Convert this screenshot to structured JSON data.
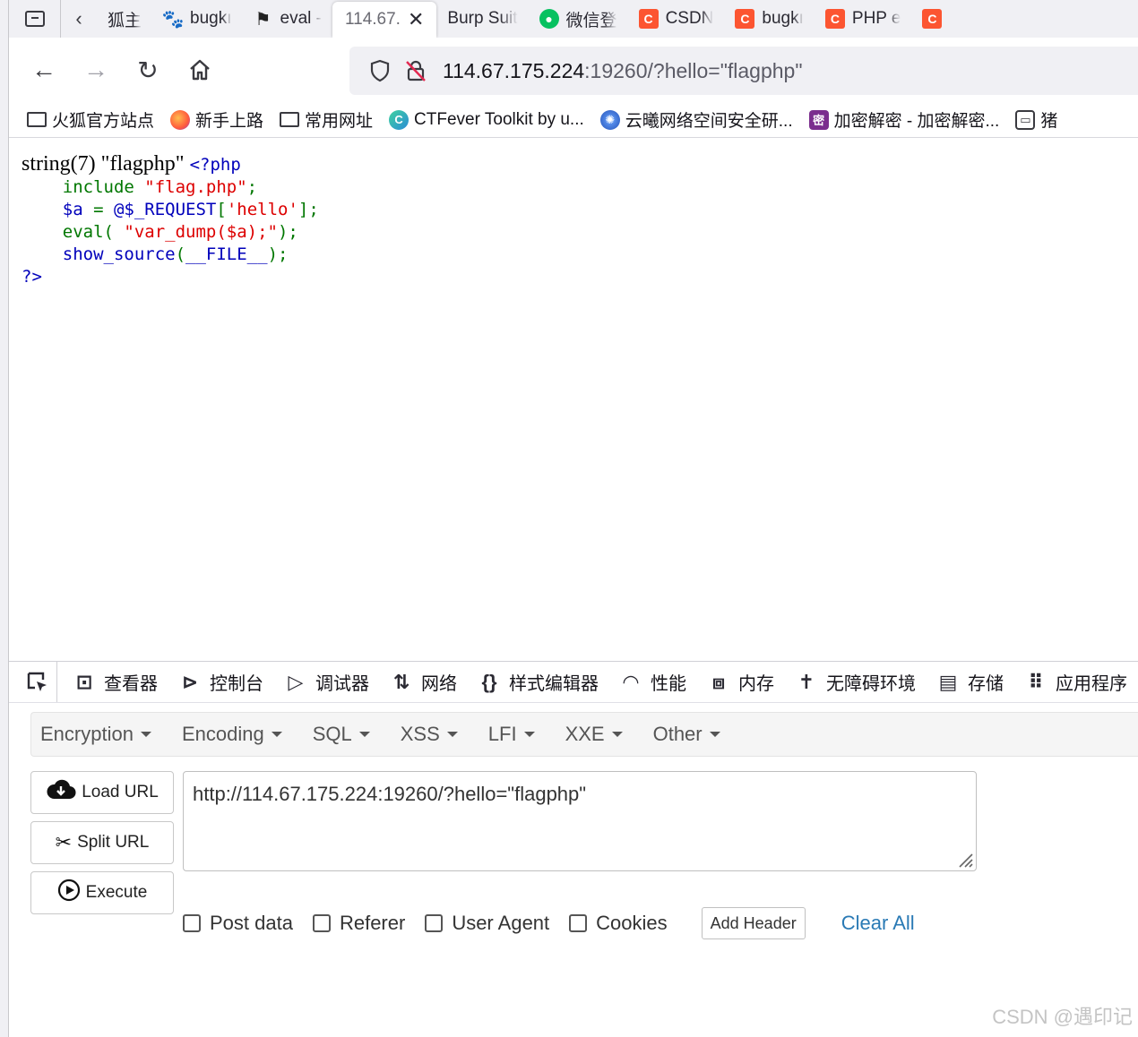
{
  "tabs": [
    {
      "label": "狐主",
      "icon": "firefox-page-icon",
      "color": "#3a3a40"
    },
    {
      "label": "bugkı",
      "icon": "baidu-paw-icon",
      "color": "#2932e1"
    },
    {
      "label": "eval -",
      "icon": "checkered-flag-icon",
      "color": "#222"
    },
    {
      "label": "114.67.",
      "icon": "",
      "color": ""
    },
    {
      "label": "Burp Suit",
      "icon": "",
      "color": ""
    },
    {
      "label": "微信登",
      "icon": "wechat-icon",
      "color": "#07c160"
    },
    {
      "label": "CSDN",
      "icon": "csdn-icon",
      "color": "#fc5531"
    },
    {
      "label": "bugkı",
      "icon": "csdn-icon",
      "color": "#fc5531"
    },
    {
      "label": "PHP e",
      "icon": "csdn-icon",
      "color": "#fc5531"
    },
    {
      "label": "",
      "icon": "csdn-icon",
      "color": "#fc5531"
    }
  ],
  "address": {
    "host": "114.67.175.224",
    "rest": ":19260/?hello=\"flagphp\""
  },
  "bookmarks": [
    {
      "label": "火狐官方站点",
      "icon": "folder-icon"
    },
    {
      "label": "新手上路",
      "icon": "firefox-icon"
    },
    {
      "label": "常用网址",
      "icon": "folder-icon"
    },
    {
      "label": "CTFever Toolkit by u...",
      "icon": "ctfever-icon"
    },
    {
      "label": "云曦网络空间安全研...",
      "icon": "yunxi-icon"
    },
    {
      "label": "加密解密 - 加密解密...",
      "icon": "crypto-icon"
    },
    {
      "label": "猪",
      "icon": "pig-icon"
    }
  ],
  "page": {
    "output": "string(7) \"flagphp\" ",
    "code": {
      "open": "<?php",
      "l1_kw": "    include ",
      "l1_str": "\"flag.php\"",
      "l1_end": ";",
      "l2_var": "    $a ",
      "l2_eq": "= ",
      "l2_req": "@$_REQUEST",
      "l2_br1": "[",
      "l2_key": "'hello'",
      "l2_br2": "];",
      "l3_fn": "    eval( ",
      "l3_str": "\"var_dump($a);\"",
      "l3_end": ");",
      "l4_fn": "    show_source",
      "l4_p1": "(",
      "l4_const": "__FILE__",
      "l4_p2": ");",
      "close": "?>"
    }
  },
  "devtools": {
    "tabs": [
      {
        "label": "查看器",
        "icon": "inspector-icon",
        "glyph": "⊡"
      },
      {
        "label": "控制台",
        "icon": "console-icon",
        "glyph": "⊳"
      },
      {
        "label": "调试器",
        "icon": "debugger-icon",
        "glyph": "▷"
      },
      {
        "label": "网络",
        "icon": "network-icon",
        "glyph": "⇅"
      },
      {
        "label": "样式编辑器",
        "icon": "style-editor-icon",
        "glyph": "{}"
      },
      {
        "label": "性能",
        "icon": "performance-icon",
        "glyph": "◠"
      },
      {
        "label": "内存",
        "icon": "memory-icon",
        "glyph": "⧈"
      },
      {
        "label": "无障碍环境",
        "icon": "accessibility-icon",
        "glyph": "✝"
      },
      {
        "label": "存储",
        "icon": "storage-icon",
        "glyph": "▤"
      },
      {
        "label": "应用程序",
        "icon": "application-icon",
        "glyph": "⠿"
      }
    ]
  },
  "hackbar": {
    "menu": [
      "Encryption",
      "Encoding",
      "SQL",
      "XSS",
      "LFI",
      "XXE",
      "Other"
    ],
    "load_url": "Load URL",
    "split_url": "Split URL",
    "execute": "Execute",
    "url_value": "http://114.67.175.224:19260/?hello=\"flagphp\"",
    "options": [
      "Post data",
      "Referer",
      "User Agent",
      "Cookies"
    ],
    "add_header": "Add Header",
    "clear_all": "Clear All"
  },
  "watermark": "CSDN @遇印记"
}
